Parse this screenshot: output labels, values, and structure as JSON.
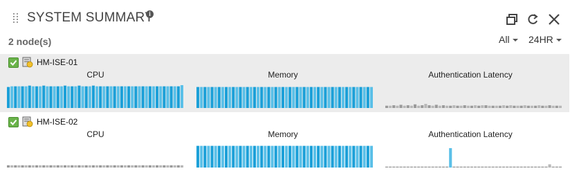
{
  "panel": {
    "title": "SYSTEM SUMMARY",
    "info_glyph": "i",
    "node_count": "2 node(s)",
    "filter_all": "All",
    "filter_time": "24HR"
  },
  "colors": {
    "cpu_bar_light": "#5bc0e8",
    "cpu_bar_dark": "#1ca0d8",
    "latency_gray": "#a8a8a8",
    "latency_spike": "#5bc0e8",
    "check_green": "#6ab34a"
  },
  "icons": [
    "drag-handle-icon",
    "info-icon",
    "popout-window-icon",
    "refresh-icon",
    "close-icon",
    "checkbox-checked-icon",
    "node-server-icon",
    "caret-down-icon"
  ],
  "nodes": [
    {
      "name": "HM-ISE-01",
      "metrics": [
        {
          "label": "CPU",
          "kind": "blue",
          "values": [
            0.92,
            0.95,
            0.95,
            0.95,
            0.95,
            0.95,
            0.98,
            0.95,
            0.95,
            0.95,
            0.98,
            0.95,
            0.95,
            0.95,
            0.95,
            0.95,
            0.98,
            0.95,
            0.95,
            0.95,
            0.98,
            0.95,
            0.95,
            0.95,
            0.98,
            0.95,
            0.95,
            0.95,
            0.95,
            0.95,
            0.95,
            0.95,
            0.95,
            0.95,
            0.95,
            0.95,
            0.95,
            0.95,
            0.95,
            0.95,
            0.95,
            0.95,
            0.95,
            0.95,
            0.95,
            0.95,
            0.95,
            0.95,
            0.95,
            1.0
          ]
        },
        {
          "label": "Memory",
          "kind": "blue",
          "values": [
            0.92,
            0.92,
            0.92,
            0.92,
            0.92,
            0.92,
            0.92,
            0.92,
            0.92,
            0.92,
            0.92,
            0.92,
            0.92,
            0.92,
            0.92,
            0.92,
            0.92,
            0.92,
            0.92,
            0.92,
            0.92,
            0.92,
            0.92,
            0.92,
            0.92,
            0.92,
            0.92,
            0.92,
            0.92,
            0.92,
            0.92,
            0.92,
            0.92,
            0.92,
            0.92,
            0.92,
            0.92,
            0.92,
            0.92,
            0.92,
            0.92,
            0.92,
            0.92,
            0.92,
            0.92,
            0.92,
            0.92,
            0.92,
            0.92,
            0.92
          ]
        },
        {
          "label": "Authentication Latency",
          "kind": "gray",
          "values": [
            0.1,
            0.1,
            0.12,
            0.1,
            0.14,
            0.1,
            0.12,
            0.1,
            0.16,
            0.1,
            0.12,
            0.18,
            0.12,
            0.1,
            0.14,
            0.1,
            0.12,
            0.1,
            0.1,
            0.12,
            0.1,
            0.1,
            0.12,
            0.1,
            0.1,
            0.12,
            0.1,
            0.12,
            0.12,
            0.1,
            0.1,
            0.1,
            0.1,
            0.12,
            0.1,
            0.12,
            0.1,
            0.1,
            0.1,
            0.12,
            0.1,
            0.1,
            0.1,
            0.12,
            0.1,
            0.1,
            0.12,
            0.1,
            0.1,
            0.1
          ]
        }
      ]
    },
    {
      "name": "HM-ISE-02",
      "metrics": [
        {
          "label": "CPU",
          "kind": "gray",
          "values": [
            0.1,
            0.1,
            0.1,
            0.1,
            0.1,
            0.1,
            0.1,
            0.1,
            0.1,
            0.1,
            0.1,
            0.1,
            0.1,
            0.1,
            0.1,
            0.1,
            0.1,
            0.1,
            0.1,
            0.1,
            0.1,
            0.1,
            0.1,
            0.1,
            0.1,
            0.1,
            0.1,
            0.1,
            0.1,
            0.1,
            0.1,
            0.1,
            0.1,
            0.1,
            0.1,
            0.1,
            0.1,
            0.1,
            0.1,
            0.1,
            0.1,
            0.1,
            0.1,
            0.1,
            0.1,
            0.1,
            0.1,
            0.1,
            0.1,
            0.1
          ]
        },
        {
          "label": "Memory",
          "kind": "blue",
          "values": [
            0.95,
            0.95,
            0.95,
            0.95,
            0.95,
            0.95,
            0.95,
            0.95,
            0.95,
            0.95,
            0.95,
            0.95,
            0.95,
            0.95,
            0.95,
            0.95,
            0.95,
            0.95,
            0.95,
            0.95,
            0.95,
            0.95,
            0.95,
            0.95,
            0.95,
            0.95,
            0.95,
            0.95,
            0.95,
            0.95,
            0.95,
            0.95,
            0.95,
            0.95,
            0.95,
            0.95,
            0.95,
            0.95,
            0.95,
            0.95,
            0.95,
            0.95,
            0.95,
            0.95,
            0.95,
            0.95,
            0.95,
            0.95,
            0.95,
            0.95
          ]
        },
        {
          "label": "Authentication Latency",
          "kind": "latency-spike",
          "values": [
            0.04,
            0.04,
            0.04,
            0.04,
            0.04,
            0.04,
            0.04,
            0.04,
            0.04,
            0.04,
            0.04,
            0.04,
            0.04,
            0.04,
            0.04,
            0.04,
            0.04,
            0.04,
            0.04,
            0.04,
            0.04,
            0.04,
            0.04,
            0.04,
            0.04,
            0.04,
            0.04,
            0.04,
            0.04,
            0.04,
            0.04,
            0.04,
            0.04,
            0.04,
            0.04,
            0.04,
            0.04,
            0.04,
            0.04,
            0.04,
            0.04,
            0.04,
            0.04,
            0.04,
            0.04,
            0.04,
            0.04,
            0.04,
            0.04,
            0.04
          ],
          "spike_index": 18,
          "spike_value": 0.85,
          "tail_index": 46,
          "tail_value": 0.14
        }
      ]
    }
  ]
}
